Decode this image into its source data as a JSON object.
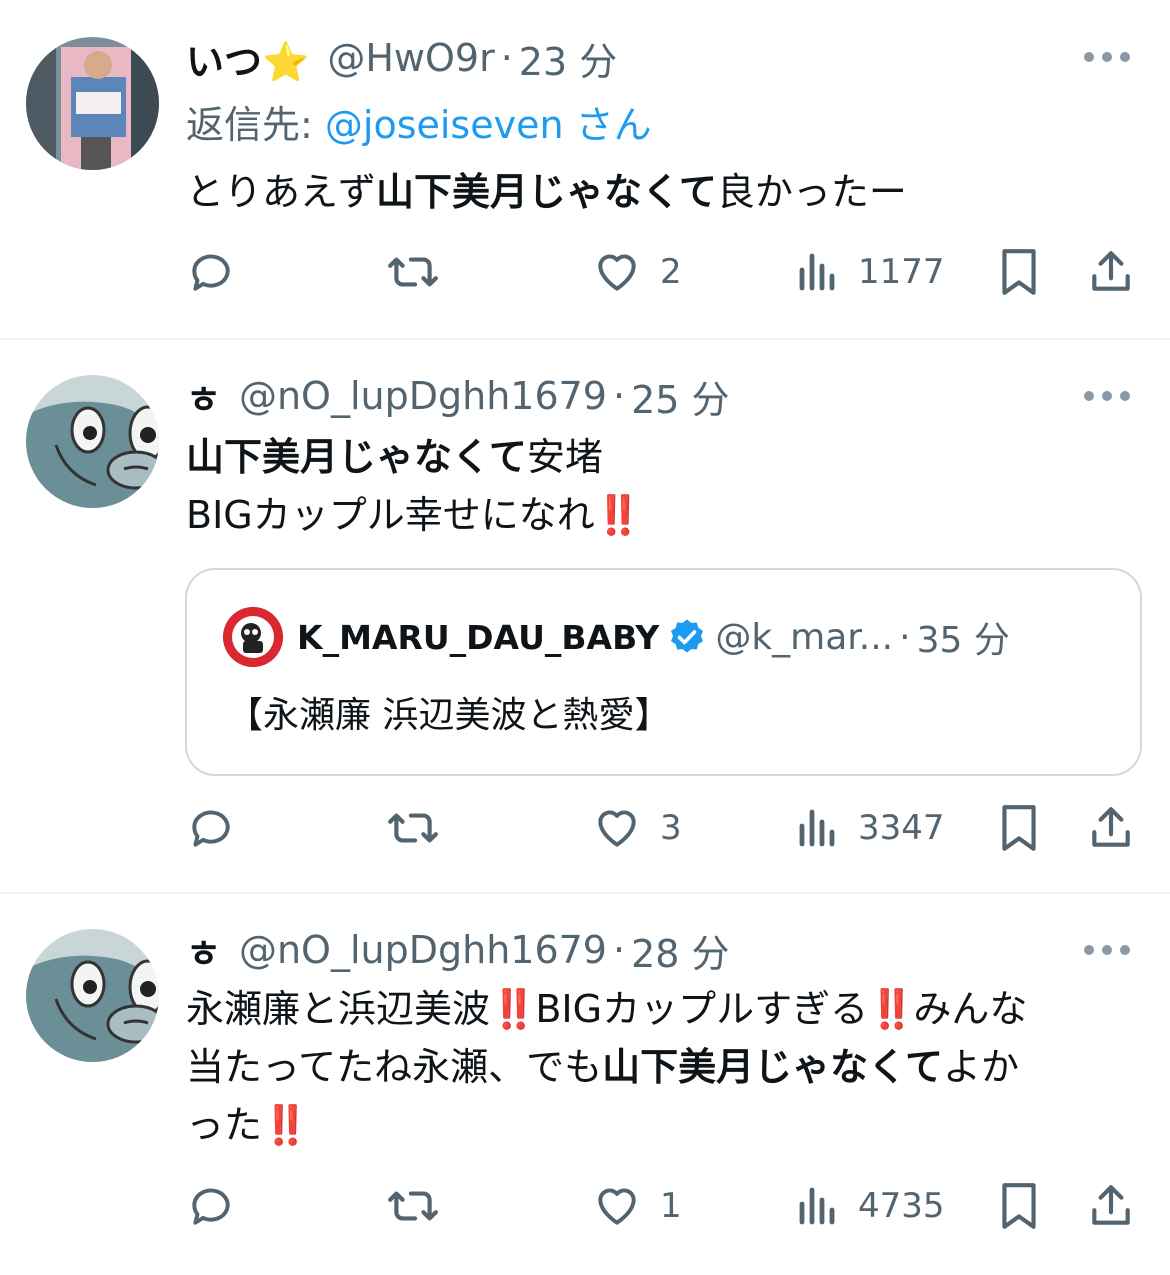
{
  "tweets": [
    {
      "author_name": "いつ⭐️",
      "handle": "@HwO9r",
      "dot": "·",
      "time": "23 分",
      "reply_prefix": "返信先: ",
      "reply_mention": "@joseiseven",
      "reply_suffix": " さん",
      "text_parts": [
        "とりあえず",
        "山下美月じゃなくて",
        "良かったー"
      ],
      "stats": {
        "likes": "2",
        "views": "1177"
      }
    },
    {
      "author_name": "ㅎ",
      "handle": "@nO_lupDghh1679",
      "dot": "·",
      "time": "25 分",
      "text_line1_parts": [
        "山下美月じゃなくて",
        "安堵"
      ],
      "text_line2": "BIGカップル幸せになれ",
      "bang": "‼️",
      "quote": {
        "name": "K_MARU_DAU_BABY",
        "handle": "@k_mar...",
        "dot": "·",
        "time": "35 分",
        "text": "【永瀬廉 浜辺美波と熱愛】"
      },
      "stats": {
        "likes": "3",
        "views": "3347"
      }
    },
    {
      "author_name": "ㅎ",
      "handle": "@nO_lupDghh1679",
      "dot": "·",
      "time": "28 分",
      "line1": [
        "永瀬廉と浜辺美波",
        "BIGカップルすぎる",
        "みんな"
      ],
      "line2": [
        "当たってたね永瀬、でも",
        "山下美月じゃなくて",
        "よか"
      ],
      "line3": "った",
      "bang": "‼️",
      "stats": {
        "likes": "1",
        "views": "4735"
      }
    }
  ],
  "icons": [
    "reply-icon",
    "retweet-icon",
    "like-icon",
    "views-icon",
    "bookmark-icon",
    "share-icon",
    "more-icon",
    "verified-icon"
  ],
  "colors": {
    "text": "#0f1419",
    "secondary": "#536471",
    "link": "#1d9bf0",
    "bang": "#e0242b",
    "divider": "#eff3f4"
  }
}
